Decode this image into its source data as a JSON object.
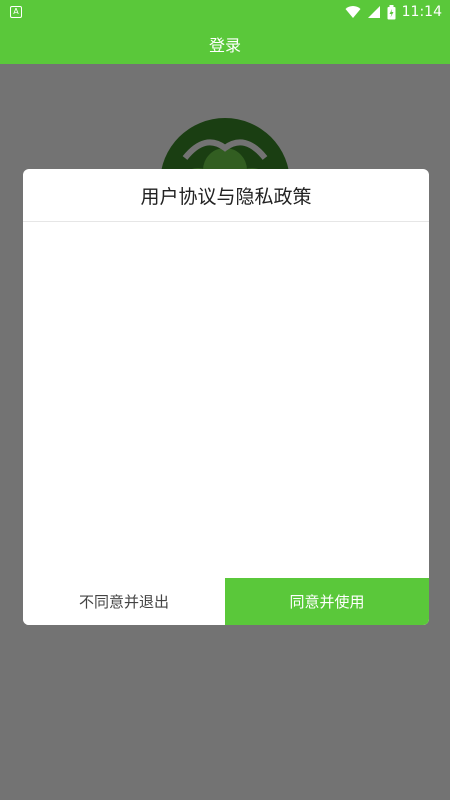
{
  "status_bar": {
    "time": "11:14",
    "left_badge": "A",
    "icons": [
      "notification-a-icon",
      "wifi-icon",
      "signal-icon",
      "battery-charging-icon"
    ]
  },
  "app_bar": {
    "title": "登录"
  },
  "dialog": {
    "title": "用户协议与隐私政策",
    "body_text": "",
    "disagree_label": "不同意并退出",
    "agree_label": "同意并使用"
  },
  "colors": {
    "brand_green": "#5ac83a",
    "overlay": "rgba(0,0,0,0.55)",
    "logo_dark_green": "#3a8a28"
  }
}
